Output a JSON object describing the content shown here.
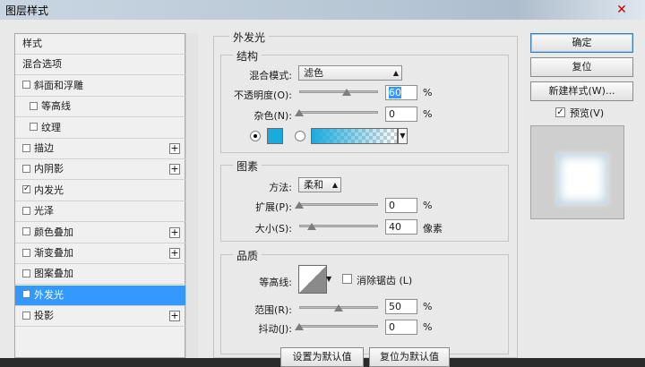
{
  "window": {
    "title": "图层样式",
    "close_glyph": "✕"
  },
  "style_list": {
    "items": [
      {
        "label": "样式",
        "checkbox": false,
        "checked": false,
        "plus": false,
        "selected": false,
        "sub": false
      },
      {
        "label": "混合选项",
        "checkbox": false,
        "checked": false,
        "plus": false,
        "selected": false,
        "sub": false
      },
      {
        "label": "斜面和浮雕",
        "checkbox": true,
        "checked": false,
        "plus": false,
        "selected": false,
        "sub": false
      },
      {
        "label": "等高线",
        "checkbox": true,
        "checked": false,
        "plus": false,
        "selected": false,
        "sub": true
      },
      {
        "label": "纹理",
        "checkbox": true,
        "checked": false,
        "plus": false,
        "selected": false,
        "sub": true
      },
      {
        "label": "描边",
        "checkbox": true,
        "checked": false,
        "plus": true,
        "selected": false,
        "sub": false
      },
      {
        "label": "内阴影",
        "checkbox": true,
        "checked": false,
        "plus": true,
        "selected": false,
        "sub": false
      },
      {
        "label": "内发光",
        "checkbox": true,
        "checked": true,
        "plus": false,
        "selected": false,
        "sub": false
      },
      {
        "label": "光泽",
        "checkbox": true,
        "checked": false,
        "plus": false,
        "selected": false,
        "sub": false
      },
      {
        "label": "颜色叠加",
        "checkbox": true,
        "checked": false,
        "plus": true,
        "selected": false,
        "sub": false
      },
      {
        "label": "渐变叠加",
        "checkbox": true,
        "checked": false,
        "plus": true,
        "selected": false,
        "sub": false
      },
      {
        "label": "图案叠加",
        "checkbox": true,
        "checked": false,
        "plus": false,
        "selected": false,
        "sub": false
      },
      {
        "label": "外发光",
        "checkbox": true,
        "checked": true,
        "plus": false,
        "selected": true,
        "sub": false
      },
      {
        "label": "投影",
        "checkbox": true,
        "checked": false,
        "plus": true,
        "selected": false,
        "sub": false
      }
    ]
  },
  "outer_glow": {
    "title": "外发光",
    "structure": {
      "title": "结构",
      "blend_mode_label": "混合模式:",
      "blend_mode_value": "滤色",
      "opacity_label": "不透明度(O):",
      "opacity_value": "60",
      "opacity_fraction": 0.6,
      "noise_label": "杂色(N):",
      "noise_value": "0",
      "noise_fraction": 0,
      "percent": "%",
      "color": "#1aabdd"
    },
    "elements": {
      "title": "图素",
      "technique_label": "方法:",
      "technique_value": "柔和",
      "spread_label": "扩展(P):",
      "spread_value": "0",
      "spread_fraction": 0,
      "size_label": "大小(S):",
      "size_value": "40",
      "size_fraction": 0.16,
      "percent": "%",
      "pixels": "像素"
    },
    "quality": {
      "title": "品质",
      "contour_label": "等高线:",
      "antialias_label": "消除锯齿 (L)",
      "range_label": "范围(R):",
      "range_value": "50",
      "range_fraction": 0.5,
      "jitter_label": "抖动(J):",
      "jitter_value": "0",
      "jitter_fraction": 0,
      "percent": "%"
    },
    "make_default": "设置为默认值",
    "reset_default": "复位为默认值"
  },
  "right_panel": {
    "ok": "确定",
    "reset": "复位",
    "new_style": "新建样式(W)...",
    "preview_label": "预览(V)",
    "preview_checked": true
  }
}
